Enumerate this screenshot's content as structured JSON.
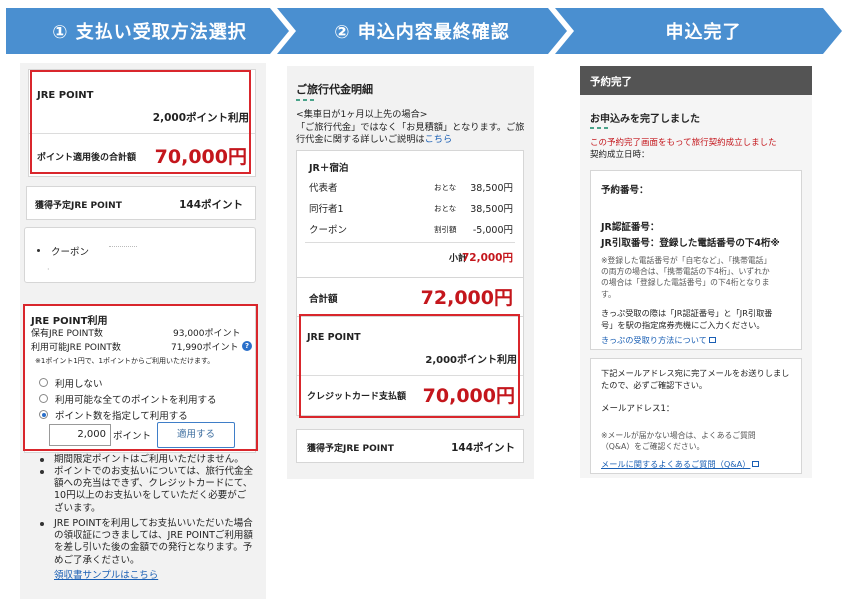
{
  "steps": {
    "step1": "① 支払い受取方法選択",
    "step2": "② 申込内容最終確認",
    "step3": "申込完了"
  },
  "panel1": {
    "jre_point_title": "JRE POINT",
    "points_used": "2,000ポイント利用",
    "total_label": "ポイント適用後の合計額",
    "total_value": "70,000円",
    "earn_label": "獲得予定JRE POINT",
    "earn_value": "144ポイント",
    "coupon_label": "クーポン",
    "use_section_title": "JRE POINT利用",
    "held_label": "保有JRE POINT数",
    "held_value": "93,000ポイント",
    "available_label": "利用可能JRE POINT数",
    "available_value": "71,990ポイント",
    "help_icon_glyph": "?",
    "note_rate": "※1ポイント1円で、1ポイントからご利用いただけます。",
    "options": [
      "利用しない",
      "利用可能な全てのポイントを利用する",
      "ポイント数を指定して利用する"
    ],
    "selected_option_index": 2,
    "points_input_value": "2,000",
    "points_unit": "ポイント",
    "apply_button": "適用する",
    "bullets": [
      [
        "期間限定ポイントはご利用いただけません。"
      ],
      [
        "ポイントでのお支払いについては、旅行代金全",
        "額への充当はできず、クレジットカードにて、",
        "10円以上のお支払いをしていただく必要がご",
        "ざいます。"
      ],
      [
        "JRE POINTを利用してお支払いいただいた場合",
        "の領収証につきましては、JRE POINTご利用額",
        "を差し引いた後の金額での発行となります。予",
        "めご了承ください。"
      ]
    ],
    "receipt_link": "領収書サンプルはこちら"
  },
  "panel2": {
    "title": "ご旅行代金明細",
    "note_lines": [
      "<集車日が1ヶ月以上先の場合>",
      "「ご旅行代金」ではなく「お見積額」となります。ご旅",
      "行代金に関する詳しいご説明は"
    ],
    "note_link": "こちら",
    "plan_title": "JR＋宿泊",
    "rows": [
      {
        "label": "代表者",
        "type": "おとな",
        "amount": "38,500円"
      },
      {
        "label": "同行者1",
        "type": "おとな",
        "amount": "38,500円"
      },
      {
        "label": "クーポン",
        "type": "割引額",
        "amount": "-5,000円"
      }
    ],
    "subtotal_label": "小計",
    "subtotal_value": "72,000円",
    "total_label": "合計額",
    "total_value": "72,000円",
    "jre_point_title": "JRE POINT",
    "points_used": "2,000ポイント利用",
    "card_label": "クレジットカード支払額",
    "card_value": "70,000円",
    "earn_label": "獲得予定JRE POINT",
    "earn_value": "144ポイント"
  },
  "panel3": {
    "header": "予約完了",
    "done_title": "お申込みを完了しました",
    "notice": "この予約完了画面をもって旅行契約成立しました",
    "contract_date_label": "契約成立日時：",
    "reservation_no_label": "予約番号：",
    "jr_auth_label": "JR認証番号：",
    "jr_pickup_label": "JR引取番号：登録した電話番号の下4桁※",
    "phone_note": [
      "※登録した電話番号が「自宅など」、「携帯電話」",
      "の両方の場合は、「携帯電話の下4桁」、いずれか",
      "の場合は「登録した電話番号」の下4桁となりま",
      "す。"
    ],
    "ticket_note": [
      "きっぷ受取の際は「JR認証番号」と「JR引取番",
      "号」を駅の指定席券売機にご入力ください。"
    ],
    "ticket_link": "きっぷの受取り方法について",
    "mail_note": [
      "下記メールアドレス宛に完了メールをお送りしまし",
      "たので、必ずご確認下さい。"
    ],
    "mail_label": "メールアドレス1：",
    "mail_missing_note": [
      "※メールが届かない場合は、よくあるご質問",
      "（Q&A）をご確認ください。"
    ],
    "faq_link": "メールに関するよくあるご質問（Q&A）"
  },
  "colors": {
    "step_blue": "#4a8fd0",
    "highlight_red": "#d9262c",
    "price_red": "#c4161c",
    "link_blue": "#1a5fb4",
    "header_gray": "#545454"
  }
}
